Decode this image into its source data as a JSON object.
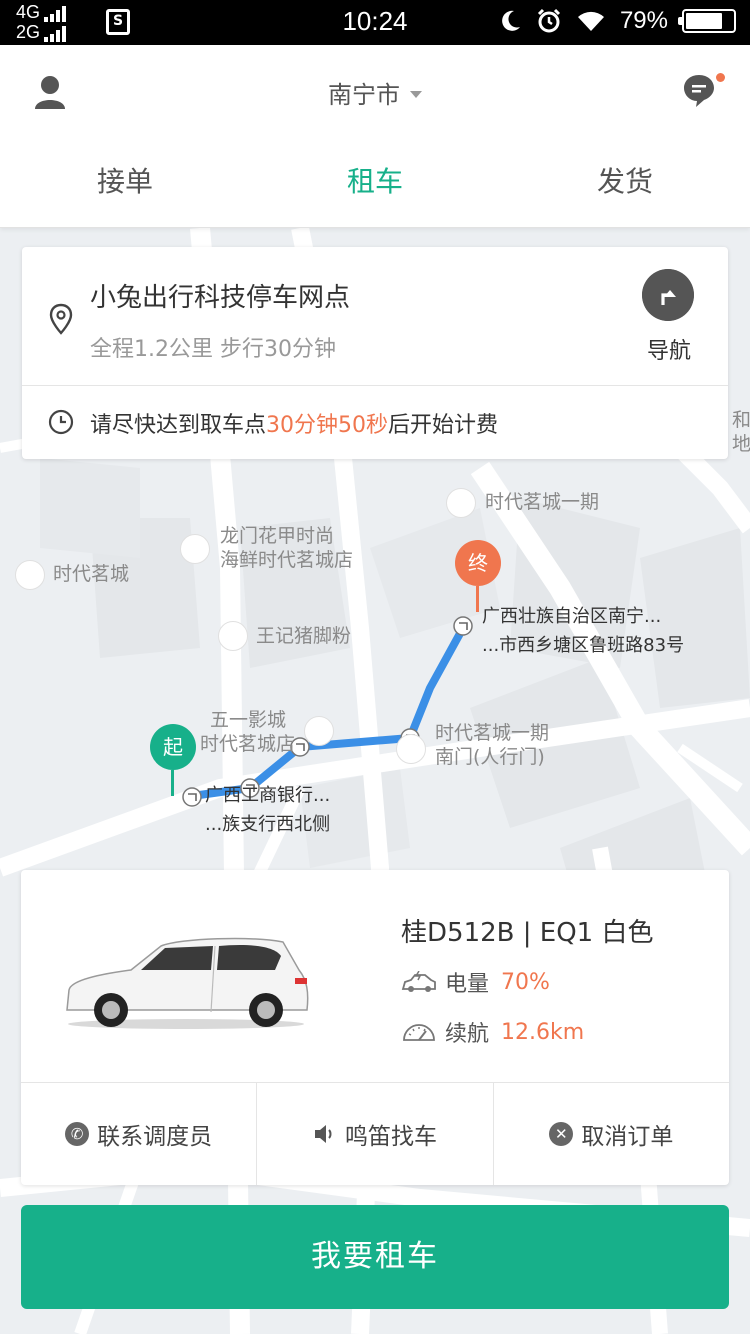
{
  "status_bar": {
    "network_top": "4G",
    "network_bottom": "2G",
    "time": "10:24",
    "battery": "79%",
    "battery_level": 0.79
  },
  "header": {
    "city": "南宁市",
    "tabs": [
      {
        "label": "接单",
        "active": false
      },
      {
        "label": "租车",
        "active": true
      },
      {
        "label": "发货",
        "active": false
      }
    ]
  },
  "info_card": {
    "place_name": "小兔出行科技停车网点",
    "place_sub": "全程1.2公里 步行30分钟",
    "nav_label": "导航",
    "notice_prefix": "请尽快达到取车点",
    "notice_time": "30分钟50秒",
    "notice_suffix": "后开始计费"
  },
  "map": {
    "labels": {
      "shidai_mingcheng_1qi": "时代茗城一期",
      "longmen_line1": "龙门花甲时尚",
      "longmen_line2": "海鲜时代茗城店",
      "shidai_mingcheng": "时代茗城",
      "wangji": "王记猪脚粉",
      "wuyi_line1": "五一影城",
      "wuyi_line2": "时代茗城店",
      "south_gate_line1": "时代茗城一期",
      "south_gate_line2": "南门(人行门)",
      "end_line1": "广西壮族自治区南宁...",
      "end_line2": "...市西乡塘区鲁班路83号",
      "start_line1": "广西工商银行...",
      "start_line2": "...族支行西北侧",
      "edge_he": "和",
      "edge_di": "地"
    },
    "start_marker": "起",
    "end_marker": "终",
    "route_color": "#3b8fe6"
  },
  "car": {
    "plate": "桂D512B | EQ1  白色",
    "battery_label": "电量",
    "battery_value": "70%",
    "range_label": "续航",
    "range_value": "12.6km"
  },
  "actions": {
    "contact": "联系调度员",
    "honk": "鸣笛找车",
    "cancel": "取消订单"
  },
  "rent_button": "我要租车",
  "colors": {
    "accent": "#17b08a",
    "highlight": "#f0764e"
  }
}
